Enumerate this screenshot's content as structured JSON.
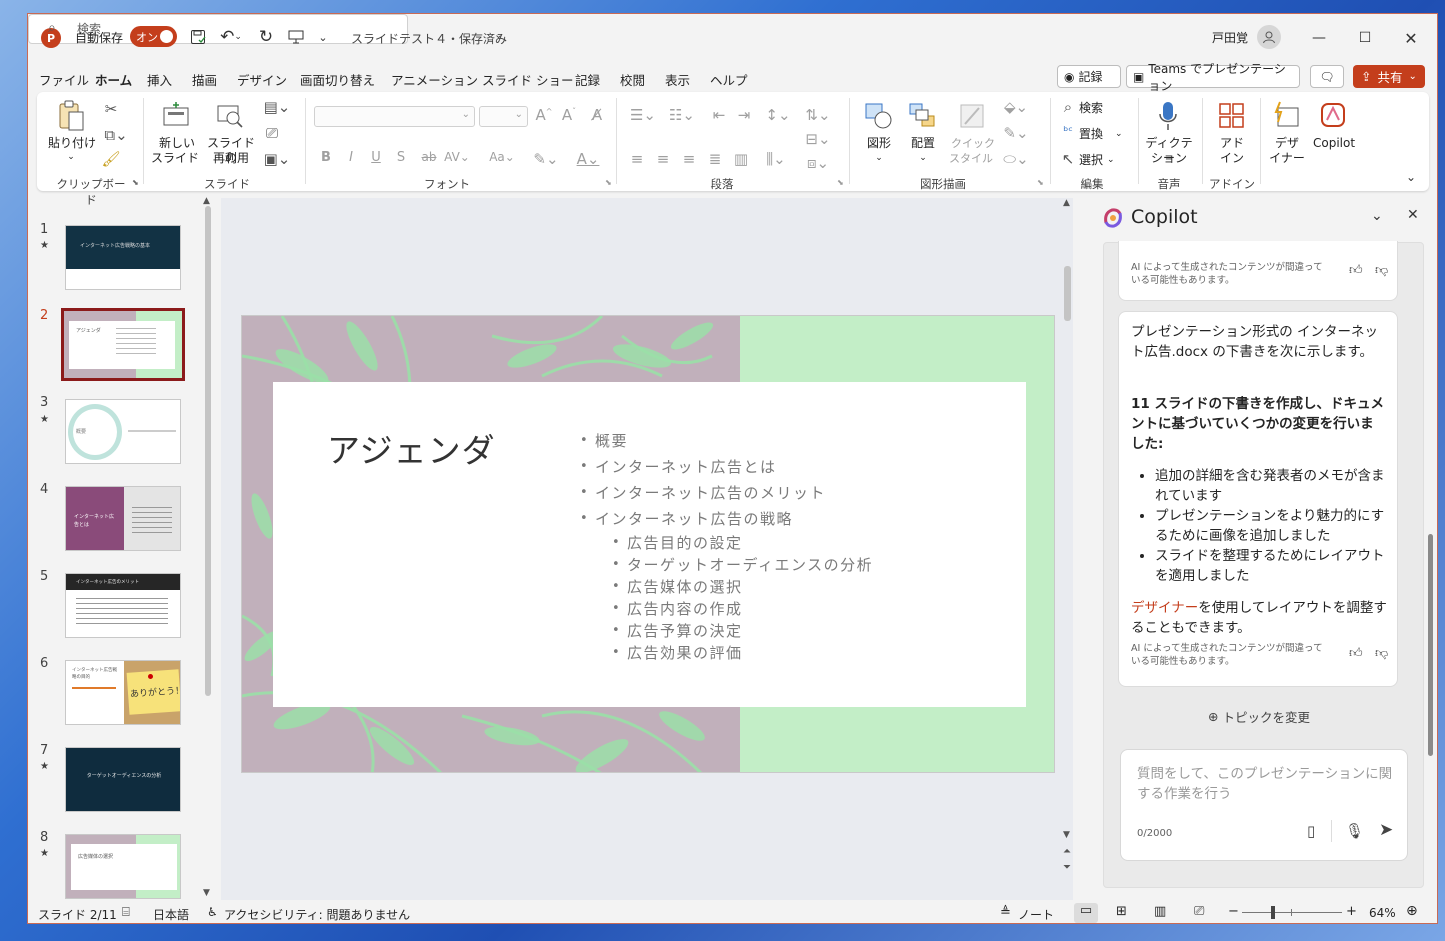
{
  "titlebar": {
    "app_icon": "P",
    "autosave_label": "自動保存",
    "autosave_state": "オン",
    "doc_title": "スライドテスト４・保存済み",
    "search_placeholder": "検索",
    "user_name": "戸田覚"
  },
  "menu": [
    "ファイル",
    "ホーム",
    "挿入",
    "描画",
    "デザイン",
    "画面切り替え",
    "アニメーション",
    "スライド ショー",
    "記録",
    "校閲",
    "表示",
    "ヘルプ"
  ],
  "menu_active": "ホーム",
  "actions": {
    "record": "記録",
    "teams": "Teams でプレゼンテーション",
    "share": "共有"
  },
  "ribbon": {
    "paste": "貼り付け",
    "clipboard": "クリップボード",
    "new_slide_1": "新しい",
    "new_slide_2": "スライド",
    "reuse_1": "スライドの",
    "reuse_2": "再利用",
    "slides": "スライド",
    "font": "フォント",
    "paragraph": "段落",
    "shape": "図形",
    "arrange": "配置",
    "quick_style_1": "クイック",
    "quick_style_2": "スタイル",
    "drawing": "図形描画",
    "find": "検索",
    "replace": "置換",
    "select": "選択",
    "editing": "編集",
    "dictate_1": "ディクテー",
    "dictate_2": "ション",
    "voice": "音声",
    "addin_1": "アド",
    "addin_2": "イン",
    "addins": "アドイン",
    "designer_1": "デザ",
    "designer_2": "イナー",
    "copilot": "Copilot"
  },
  "thumbnails": [
    {
      "num": "1",
      "star": "★",
      "title": "インターネット広告戦略の基本"
    },
    {
      "num": "2",
      "star": "",
      "title": "アジェンダ"
    },
    {
      "num": "3",
      "star": "★",
      "title": "概要"
    },
    {
      "num": "4",
      "star": "",
      "title": "インターネット広告とは"
    },
    {
      "num": "5",
      "star": "",
      "title": "インターネット広告のメリット"
    },
    {
      "num": "6",
      "star": "",
      "title": "インターネット広告戦略の目的",
      "sticker": "ありがとう！"
    },
    {
      "num": "7",
      "star": "★",
      "title": "ターゲットオーディエンスの分析"
    },
    {
      "num": "8",
      "star": "★",
      "title": "広告媒体の選択"
    }
  ],
  "slide": {
    "title": "アジェンダ",
    "bullets": [
      "概要",
      "インターネット広告とは",
      "インターネット広告のメリット",
      "インターネット広告の戦略"
    ],
    "sub_bullets": [
      "広告目的の設定",
      "ターゲットオーディエンスの分析",
      "広告媒体の選択",
      "広告内容の作成",
      "広告予算の決定",
      "広告効果の評価"
    ],
    "colors": {
      "left_panel": "#c1b0bb",
      "right_panel": "#c3eec7",
      "leaf": "#9be0a8"
    }
  },
  "copilot": {
    "title": "Copilot",
    "ai_note": "AI によって生成されたコンテンツが間違っている可能性もあります。",
    "msg_intro": "プレゼンテーション形式の インターネット広告.docx の下書きを次に示します。",
    "msg_bold": "11 スライドの下書きを作成し、ドキュメントに基づいていくつかの変更を行いました:",
    "msg_items": [
      "追加の詳細を含む発表者のメモが含まれています",
      "プレゼンテーションをより魅力的にするために画像を追加しました",
      "スライドを整理するためにレイアウトを適用しました"
    ],
    "designer_link": "デザイナー",
    "designer_rest": "を使用してレイアウトを調整することもできます。",
    "change_topic": "トピックを変更",
    "input_placeholder": "質問をして、このプレゼンテーションに関する作業を行う",
    "char_count": "0/2000"
  },
  "status": {
    "slide": "スライド 2/11",
    "lang": "日本語",
    "accessibility": "アクセシビリティ: 問題ありません",
    "notes": "ノート",
    "zoom": "64%"
  }
}
